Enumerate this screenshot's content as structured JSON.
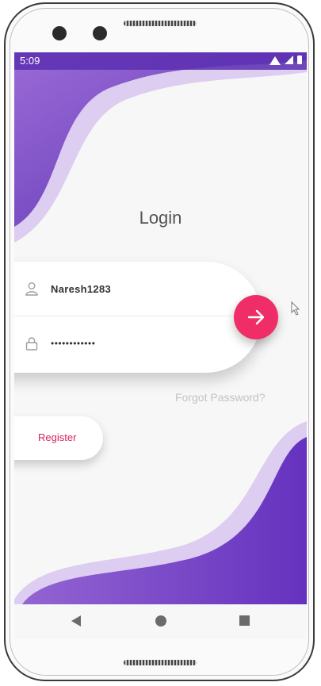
{
  "status_bar": {
    "time": "5:09"
  },
  "login": {
    "title": "Login",
    "username_value": "Naresh1283",
    "password_value": "••••••••••••",
    "forgot_password": "Forgot Password?",
    "register_label": "Register"
  },
  "icons": {
    "user": "user-icon",
    "lock": "lock-icon",
    "arrow": "arrow-right-icon",
    "back": "back-icon",
    "home": "home-icon",
    "recents": "recents-icon"
  },
  "colors": {
    "wave_purple": "#6a3fc0",
    "wave_light": "#d9c8ee",
    "accent_pink": "#ef2e67",
    "register_text": "#d4245b"
  }
}
